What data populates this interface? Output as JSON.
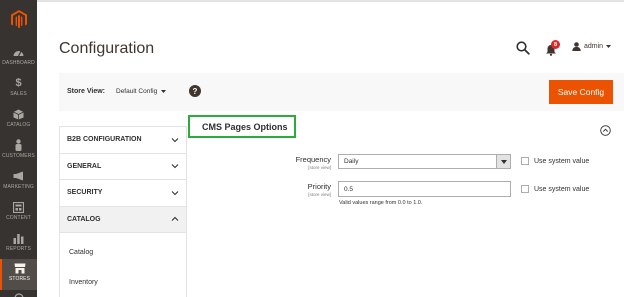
{
  "sidebar": {
    "logo": "magento-logo",
    "items": [
      {
        "label": "DASHBOARD",
        "icon": "dashboard-icon"
      },
      {
        "label": "SALES",
        "icon": "dollar-icon"
      },
      {
        "label": "CATALOG",
        "icon": "box-icon"
      },
      {
        "label": "CUSTOMERS",
        "icon": "person-icon"
      },
      {
        "label": "MARKETING",
        "icon": "megaphone-icon"
      },
      {
        "label": "CONTENT",
        "icon": "content-icon"
      },
      {
        "label": "REPORTS",
        "icon": "bar-chart-icon"
      },
      {
        "label": "STORES",
        "icon": "store-icon"
      }
    ],
    "active_index": 7
  },
  "header": {
    "title": "Configuration",
    "notifications_count": "8",
    "user_name": "admin"
  },
  "store_bar": {
    "label": "Store View:",
    "value": "Default Config",
    "help": "?",
    "save_label": "Save Config"
  },
  "config_tabs": [
    {
      "label": "B2B CONFIGURATION",
      "expanded": false
    },
    {
      "label": "GENERAL",
      "expanded": false
    },
    {
      "label": "SECURITY",
      "expanded": false
    },
    {
      "label": "CATALOG",
      "expanded": true
    }
  ],
  "catalog_items": [
    "Catalog",
    "Inventory"
  ],
  "section": {
    "title": "CMS Pages Options",
    "frequency": {
      "label": "Frequency",
      "scope": "[store view]",
      "value": "Daily",
      "system_label": "Use system value"
    },
    "priority": {
      "label": "Priority",
      "scope": "[store view]",
      "value": "0.5",
      "note": "Valid values range from 0.0 to 1.0.",
      "system_label": "Use system value"
    }
  },
  "colors": {
    "sidebar_bg": "#373330",
    "accent": "#eb5202",
    "highlight_box": "#2bab3b",
    "badge": "#e22626"
  }
}
